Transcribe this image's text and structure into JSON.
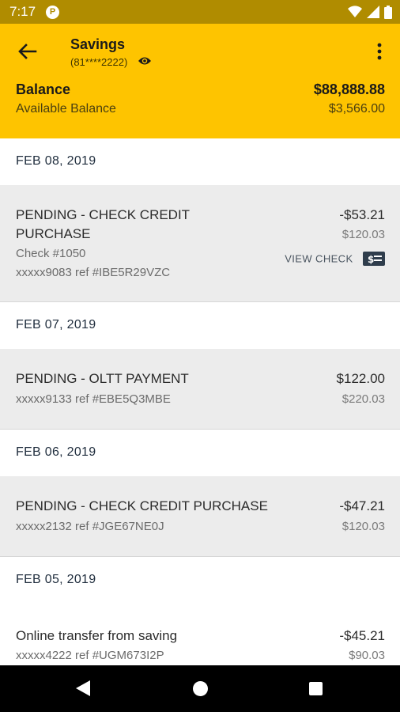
{
  "status_bar": {
    "time": "7:17",
    "app_icon_letter": "P",
    "icons": [
      "wifi-icon",
      "signal-icon",
      "battery-icon"
    ]
  },
  "header": {
    "title": "Savings",
    "account_number": "(81****2222)",
    "balance_label": "Balance",
    "balance_value": "$88,888.88",
    "available_label": "Available Balance",
    "available_value": "$3,566.00"
  },
  "colors": {
    "accent": "#fec400",
    "status_bar": "#b08c00",
    "row_bg": "#ececec"
  },
  "groups": [
    {
      "date": "FEB 08, 2019",
      "txn": {
        "desc_line1": "PENDING - CHECK CREDIT",
        "desc_line2": "PURCHASE",
        "check_no": "Check #1050",
        "ref": "xxxxx9083 ref #IBE5R29VZC",
        "amount": "-$53.21",
        "balance": "$120.03",
        "view_check_label": "VIEW CHECK"
      }
    },
    {
      "date": "FEB 07, 2019",
      "txn": {
        "desc": "PENDING - OLTT PAYMENT",
        "ref": "xxxxx9133 ref #EBE5Q3MBE",
        "amount": "$122.00",
        "balance": "$220.03"
      }
    },
    {
      "date": "FEB 06, 2019",
      "txn": {
        "desc": "PENDING - CHECK CREDIT PURCHASE",
        "ref": "xxxxx2132 ref #JGE67NE0J",
        "amount": "-$47.21",
        "balance": "$120.03"
      }
    },
    {
      "date": "FEB 05, 2019",
      "txn": {
        "desc": "Online transfer from saving",
        "ref": "xxxxx4222 ref #UGM673I2P",
        "amount": "-$45.21",
        "balance": "$90.03"
      }
    }
  ]
}
